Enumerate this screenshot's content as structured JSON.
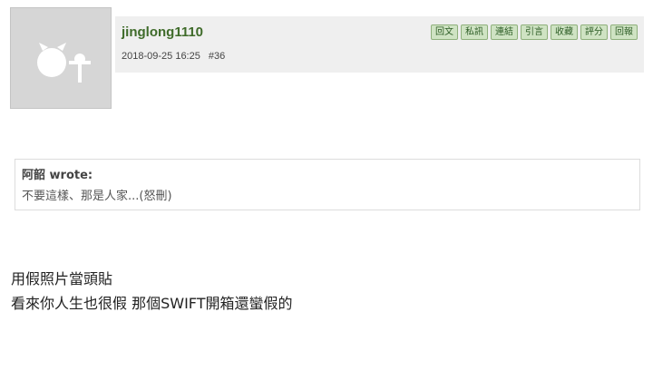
{
  "post": {
    "username": "jinglong1110",
    "datetime": "2018-09-25 16:25",
    "floor": "#36",
    "actions": [
      "回文",
      "私訊",
      "連結",
      "引言",
      "收藏",
      "評分",
      "回報"
    ],
    "quote": {
      "author": "阿韶 wrote:",
      "text": "不要這樣、那是人家...(怒刪)"
    },
    "body": [
      "用假照片當頭貼",
      "看來你人生也很假 那個SWIFT開箱還蠻假的"
    ]
  },
  "colors": {
    "username": "#3f6b2a",
    "button_bg": "#cfe3c3",
    "button_border": "#8fb07c",
    "header_bg": "#efefef",
    "avatar_bg": "#d6d6d6"
  },
  "icons": {
    "avatar": "default-avatar-icon"
  }
}
